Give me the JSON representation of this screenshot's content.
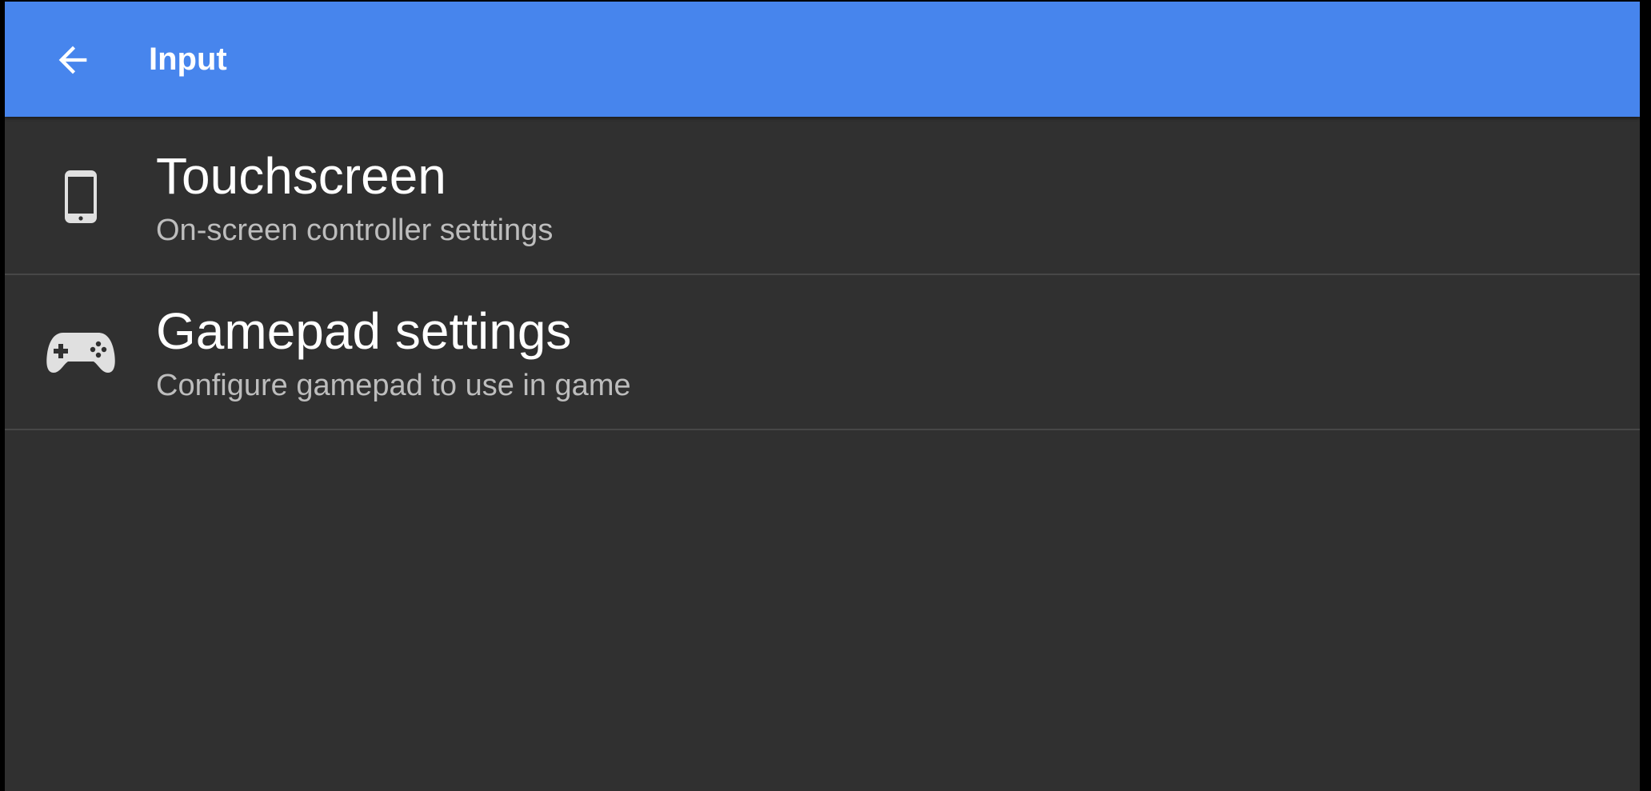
{
  "colors": {
    "app_bar": "#4785ED",
    "background": "#303030",
    "divider": "#474747",
    "title_text": "#FFFFFF",
    "subtitle_text": "#BDBDBD",
    "icon": "#E0E0E0"
  },
  "app_bar": {
    "title": "Input",
    "back_icon": "arrow-left-icon"
  },
  "items": [
    {
      "icon": "smartphone-icon",
      "title": "Touchscreen",
      "subtitle": "On-screen controller setttings"
    },
    {
      "icon": "gamepad-icon",
      "title": "Gamepad settings",
      "subtitle": "Configure gamepad to use in game"
    }
  ]
}
